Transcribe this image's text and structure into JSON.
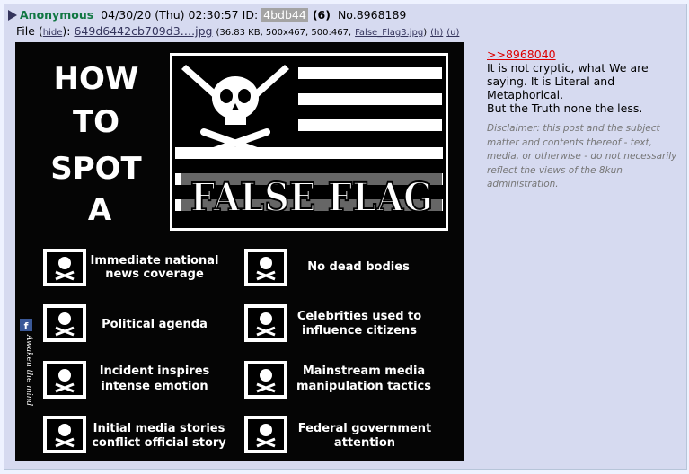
{
  "post": {
    "name": "Anonymous",
    "datetime": "04/30/20 (Thu) 02:30:57",
    "id_label": "ID:",
    "poster_id": "4bdb44",
    "reply_count": "(6)",
    "post_no": "No.8968189",
    "file": {
      "prefix": "File (",
      "hide": "hide",
      "sep": "):",
      "name": "649d6442cb709d3….jpg",
      "meta_open": "(36.83 KB, 500x467, 500:467,",
      "orig_name": "False_Flag3.jpg",
      "meta_close": ")",
      "h": "(h)",
      "u": "(u)"
    },
    "quote_link": ">>8968040",
    "body_lines": [
      "It is not cryptic, what We are saying. It is Literal and Metaphorical.",
      "But the Truth none the less."
    ],
    "disclaimer": "Disclaimer: this post and the subject matter and contents thereof - text, media, or otherwise - do not necessarily reflect the views of the 8kun administration."
  },
  "image": {
    "title_lines": [
      "HOW",
      "TO",
      "SPOT",
      "A"
    ],
    "banner": "FALSE FLAG",
    "side_text": "Awaken the mind",
    "items_left": [
      [
        "Immediate national",
        "news coverage"
      ],
      [
        "Political agenda"
      ],
      [
        "Incident inspires",
        "intense emotion"
      ],
      [
        "Initial media stories",
        "conflict official story"
      ]
    ],
    "items_right": [
      [
        "No dead bodies"
      ],
      [
        "Celebrities used to",
        "influence citizens"
      ],
      [
        "Mainstream media",
        "manipulation tactics"
      ],
      [
        "Federal government",
        "attention"
      ]
    ]
  }
}
